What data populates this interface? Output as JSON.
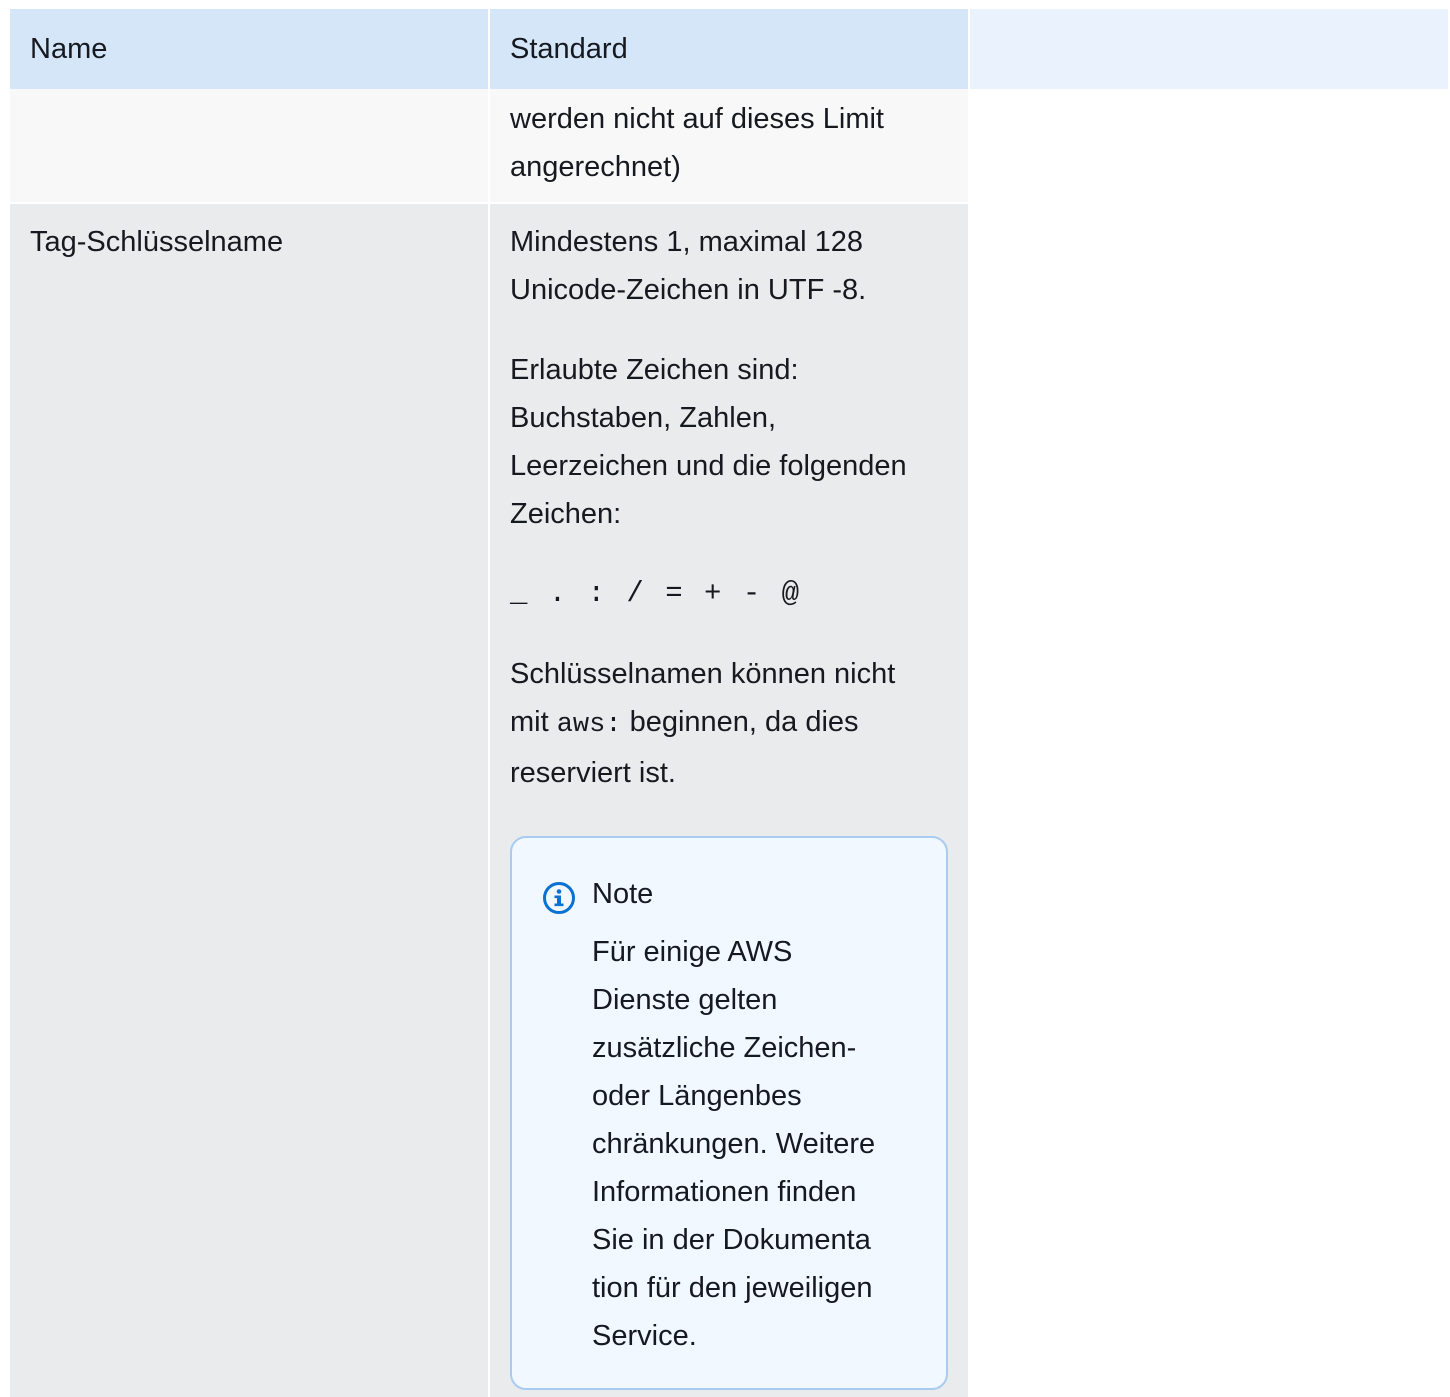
{
  "table": {
    "header": {
      "name": "Name",
      "standard": "Standard"
    },
    "row_continued": {
      "name": "",
      "standard_lines": [
        "werden nicht auf dieses Limit",
        "angerechnet)"
      ]
    },
    "row_tag_key": {
      "name": "Tag-Schlüsselname",
      "para1_lines": [
        "Mindestens 1, maximal 128",
        "Unicode-Zeichen in UTF -8."
      ],
      "para2_lines": [
        "Erlaubte Zeichen sind:",
        "Buchstaben, Zahlen,",
        "Leerzeichen und die folgenden",
        "Zeichen:"
      ],
      "allowed_chars": "_ . : / = + - @",
      "para3_line1": "Schlüsselnamen können nicht",
      "para3_prefix": "mit ",
      "para3_code": "aws:",
      "para3_suffix": " beginnen, da dies",
      "para3_line3": "reserviert ist.",
      "note": {
        "icon": "info-icon",
        "title": "Note",
        "body_lines": [
          "Für einige AWS",
          "Dienste gelten",
          "zusätzliche Zeichen-",
          "oder Längenbes",
          "chränkungen. Weitere",
          "Informationen finden",
          "Sie in der Dokumenta",
          "tion für den jeweiligen",
          "Service."
        ]
      }
    }
  },
  "colors": {
    "header_bg": "#d4e6f8",
    "header_extra_bg": "#eaf3fd",
    "row_light_bg": "#f8f8f8",
    "row_gray_bg": "#e9ebed",
    "note_border": "#a9cbf0",
    "note_bg": "#f1f8ff",
    "info_icon": "#0972d3"
  }
}
